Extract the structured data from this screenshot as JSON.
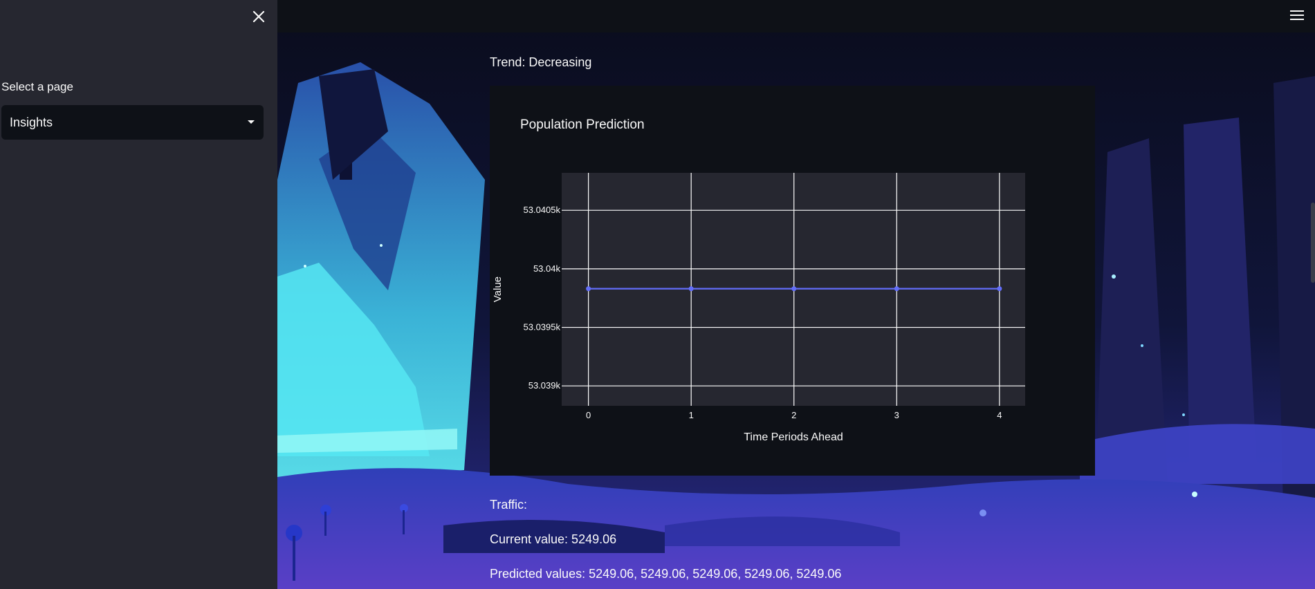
{
  "sidebar": {
    "label": "Select a page",
    "select_value": "Insights"
  },
  "main": {
    "trend_text": "Trend: Decreasing",
    "traffic_label": "Traffic:",
    "current_value_text": "Current value: 5249.06",
    "predicted_values_text": "Predicted values: 5249.06, 5249.06, 5249.06, 5249.06, 5249.06"
  },
  "chart_data": {
    "type": "line",
    "title": "Population Prediction",
    "xlabel": "Time Periods Ahead",
    "ylabel": "Value",
    "x": [
      0,
      1,
      2,
      3,
      4
    ],
    "series": [
      {
        "values": [
          53039.83,
          53039.83,
          53039.83,
          53039.83,
          53039.83
        ]
      }
    ],
    "x_ticks": [
      "0",
      "1",
      "2",
      "3",
      "4"
    ],
    "y_ticks": [
      {
        "value": 53039,
        "label": "53.039k"
      },
      {
        "value": 53039.5,
        "label": "53.0395k"
      },
      {
        "value": 53040,
        "label": "53.04k"
      },
      {
        "value": 53040.5,
        "label": "53.0405k"
      }
    ],
    "xlim": [
      -0.26,
      4.25
    ],
    "ylim": [
      53038.83,
      53040.82
    ],
    "grid": true,
    "colors": {
      "line": "#636efa",
      "plot_bg": "#262730",
      "grid": "#ffffff"
    }
  }
}
